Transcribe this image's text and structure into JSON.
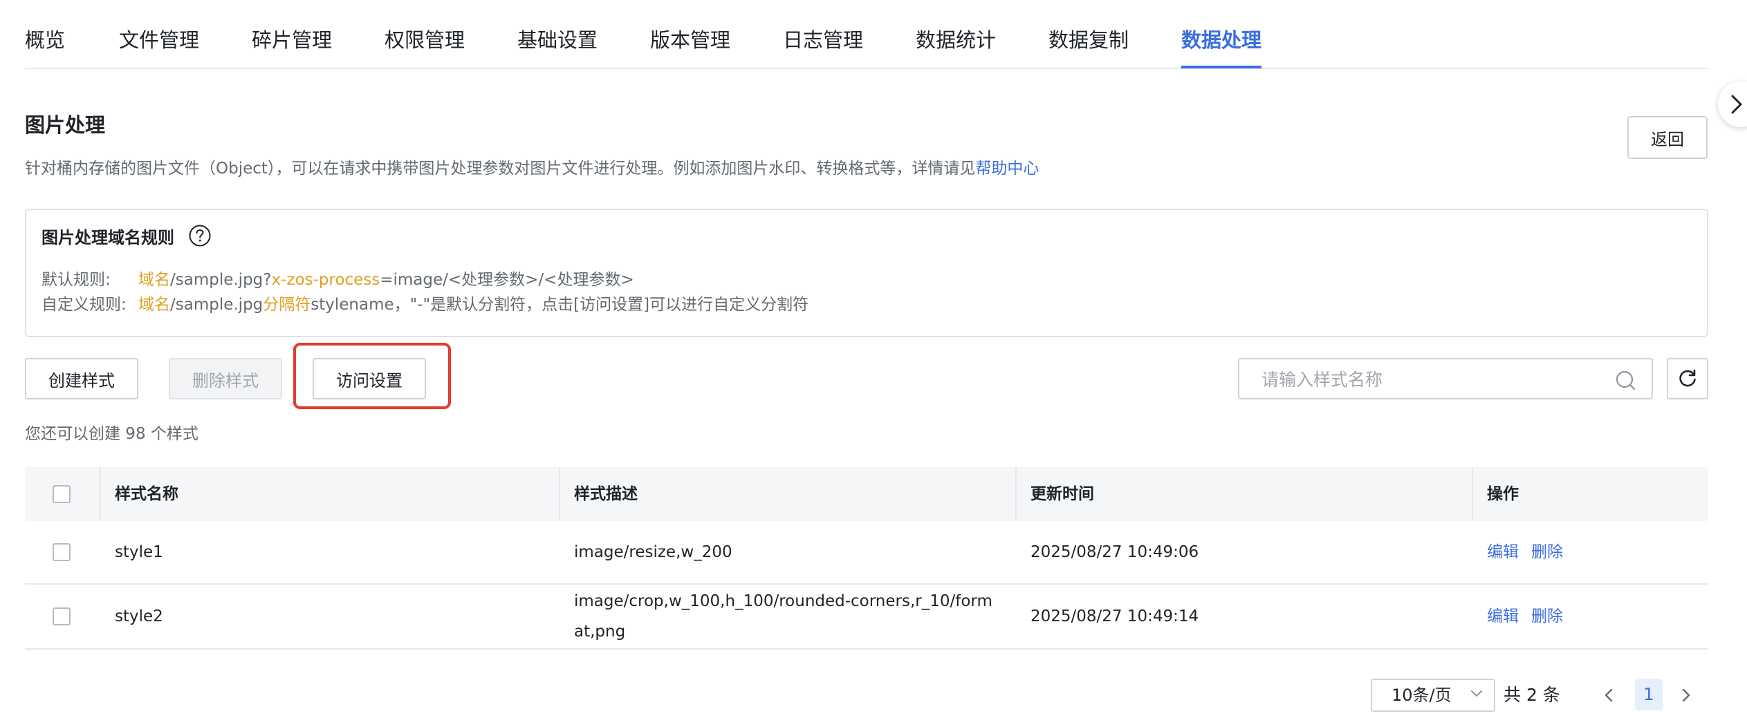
{
  "tabs": [
    {
      "label": "概览",
      "active": false
    },
    {
      "label": "文件管理",
      "active": false
    },
    {
      "label": "碎片管理",
      "active": false
    },
    {
      "label": "权限管理",
      "active": false
    },
    {
      "label": "基础设置",
      "active": false
    },
    {
      "label": "版本管理",
      "active": false
    },
    {
      "label": "日志管理",
      "active": false
    },
    {
      "label": "数据统计",
      "active": false
    },
    {
      "label": "数据复制",
      "active": false
    },
    {
      "label": "数据处理",
      "active": true
    }
  ],
  "header": {
    "title": "图片处理",
    "description": "针对桶内存储的图片文件（Object），可以在请求中携带图片处理参数对图片文件进行处理。例如添加图片水印、转换格式等，详情请见",
    "help_link": "帮助中心",
    "back_label": "返回"
  },
  "rule_box": {
    "title": "图片处理域名规则",
    "default_label": "默认规则:",
    "default_parts": {
      "domain": "域名",
      "path": "/sample.jpg?",
      "param": "x-zos-process",
      "rest": "=image/<处理参数>/<处理参数>"
    },
    "custom_label": "自定义规则:",
    "custom_parts": {
      "domain": "域名",
      "path": "/sample.jpg",
      "sep": "分隔符",
      "rest": "stylename，\"-\"是默认分割符，点击[访问设置]可以进行自定义分割符"
    }
  },
  "toolbar": {
    "create_label": "创建样式",
    "delete_label": "删除样式",
    "access_label": "访问设置",
    "search_placeholder": "请输入样式名称",
    "quota_text": "您还可以创建 98 个样式"
  },
  "table": {
    "columns": [
      "样式名称",
      "样式描述",
      "更新时间",
      "操作"
    ],
    "rows": [
      {
        "name": "style1",
        "desc": "image/resize,w_200",
        "time": "2025/08/27 10:49:06",
        "edit": "编辑",
        "delete": "删除"
      },
      {
        "name": "style2",
        "desc": "image/crop,w_100,h_100/rounded-corners,r_10/format,png",
        "time": "2025/08/27 10:49:14",
        "edit": "编辑",
        "delete": "删除"
      }
    ]
  },
  "pagination": {
    "page_size": "10条/页",
    "total": "共 2 条",
    "current_page": "1"
  },
  "colors": {
    "accent": "#3b6fe0",
    "highlight_orange": "#e0a022",
    "annotation_red": "#e23b2e"
  }
}
